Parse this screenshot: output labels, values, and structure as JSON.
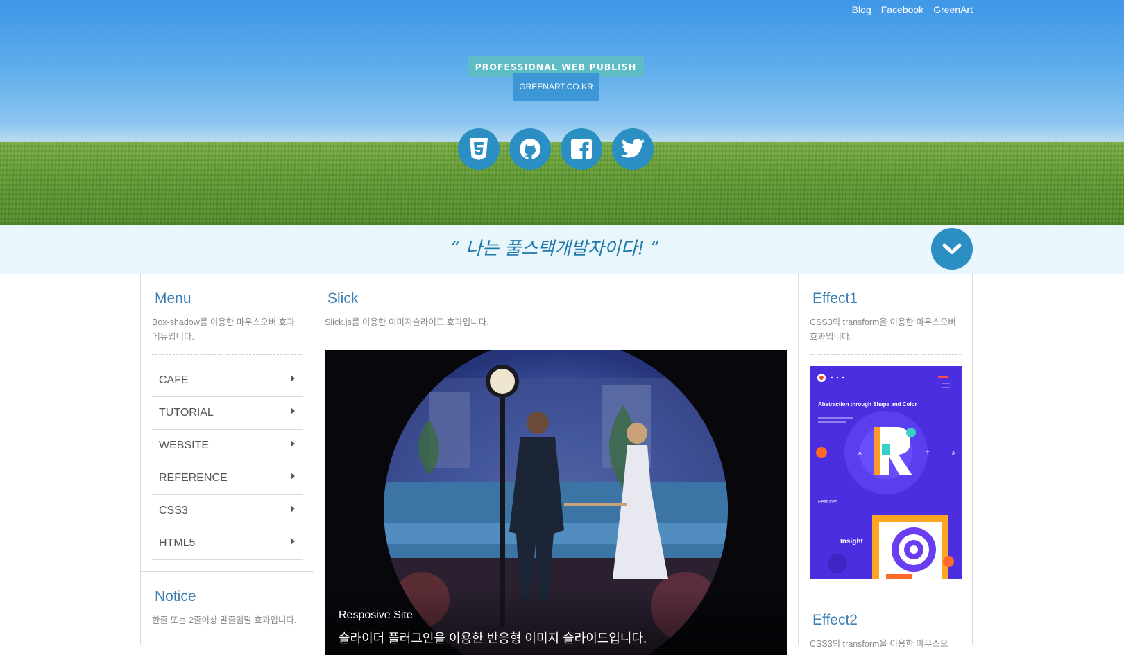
{
  "header": {
    "links": [
      "Blog",
      "Facebook",
      "GreenArt"
    ],
    "badge_title": "PROFESSIONAL WEB PUBLISH",
    "badge_site": "GREENART.CO.KR",
    "social_icons": [
      "html5-icon",
      "github-icon",
      "facebook-icon",
      "twitter-icon"
    ]
  },
  "quote": {
    "text": "“ 나는 풀스택개발자이다! ”"
  },
  "left": {
    "menu_title": "Menu",
    "menu_desc": "Box-shadow를 이용한 마우스오버 효과 메뉴입니다.",
    "menu_items": [
      "CAFE",
      "TUTORIAL",
      "WEBSITE",
      "REFERENCE",
      "CSS3",
      "HTML5"
    ],
    "notice_title": "Notice",
    "notice_desc": "한줄 또는 2줄이상 말줄임말 효과입니다."
  },
  "main": {
    "title": "Slick",
    "desc": "Slick.js를 이용한 이미지슬라이드 효과입니다.",
    "caption_title": "Resposive Site",
    "caption_text": "슬라이더 플러그인을 이용한 반응형 이미지 슬라이드입니다."
  },
  "right": {
    "effect1_title": "Effect1",
    "effect1_desc": "CSS3의 transform을 이용한 마우스오버효과입니다.",
    "thumb_heading": "Abstraction through Shape and Color",
    "thumb_featured": "Featured",
    "thumb_insight": "Insight",
    "thumb_letters": [
      "A",
      "T",
      "A"
    ],
    "effect2_title": "Effect2",
    "effect2_desc": "CSS3의 transform을 이용한 마우스오"
  },
  "colors": {
    "accent": "#2c8fc3",
    "title_blue": "#3b7fb3",
    "badge_teal": "#5dbcc6",
    "badge_blue": "#3d97d7",
    "quote_bg": "#e9f6fc"
  }
}
